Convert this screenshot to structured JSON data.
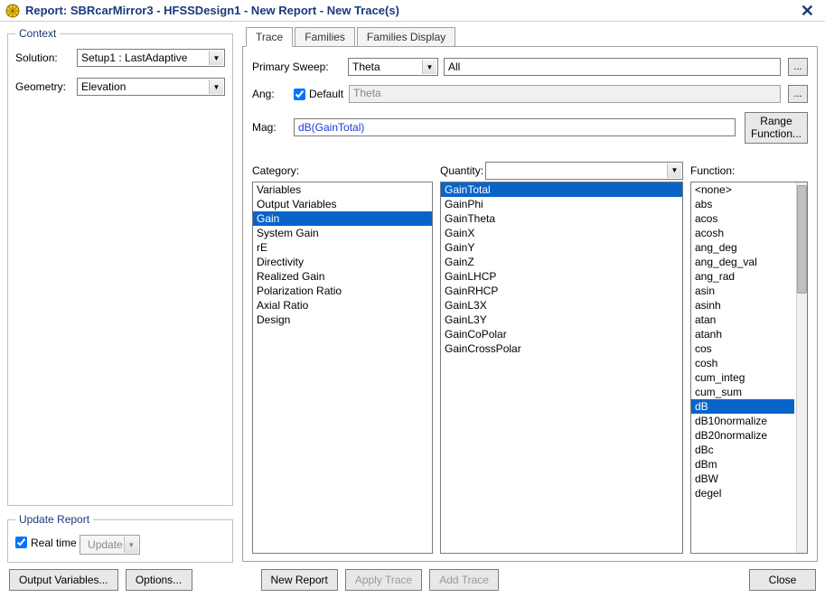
{
  "title": "Report: SBRcarMirror3 - HFSSDesign1 - New Report - New Trace(s)",
  "close_glyph": "✕",
  "context": {
    "legend": "Context",
    "solution_label": "Solution:",
    "solution_value": "Setup1 : LastAdaptive",
    "geometry_label": "Geometry:",
    "geometry_value": "Elevation"
  },
  "update_report": {
    "legend": "Update Report",
    "realtime_label": "Real time",
    "realtime_checked": true,
    "update_label": "Update"
  },
  "tabs": {
    "items": [
      "Trace",
      "Families",
      "Families Display"
    ],
    "active": 0
  },
  "trace": {
    "primary_sweep_label": "Primary Sweep:",
    "primary_sweep_value": "Theta",
    "primary_sweep_scope": "All",
    "ang_label": "Ang:",
    "ang_default_label": "Default",
    "ang_default_checked": true,
    "ang_value": "Theta",
    "mag_label": "Mag:",
    "mag_value": "dB(GainTotal)",
    "range_btn": "Range\nFunction...",
    "category_label": "Category:",
    "quantity_label": "Quantity:",
    "function_label": "Function:",
    "categories": [
      "Variables",
      "Output Variables",
      "Gain",
      "System Gain",
      "rE",
      "Directivity",
      "Realized Gain",
      "Polarization Ratio",
      "Axial Ratio",
      "Design"
    ],
    "category_selected": 2,
    "quantities": [
      "GainTotal",
      "GainPhi",
      "GainTheta",
      "GainX",
      "GainY",
      "GainZ",
      "GainLHCP",
      "GainRHCP",
      "GainL3X",
      "GainL3Y",
      "GainCoPolar",
      "GainCrossPolar"
    ],
    "quantity_selected": 0,
    "functions": [
      "<none>",
      "abs",
      "acos",
      "acosh",
      "ang_deg",
      "ang_deg_val",
      "ang_rad",
      "asin",
      "asinh",
      "atan",
      "atanh",
      "cos",
      "cosh",
      "cum_integ",
      "cum_sum",
      "dB",
      "dB10normalize",
      "dB20normalize",
      "dBc",
      "dBm",
      "dBW",
      "degel"
    ],
    "function_selected": 15
  },
  "footer": {
    "output_vars": "Output Variables...",
    "options": "Options...",
    "new_report": "New Report",
    "apply_trace": "Apply Trace",
    "add_trace": "Add Trace",
    "close": "Close"
  },
  "icons": {
    "dropdown": "▼",
    "dots": "..."
  }
}
